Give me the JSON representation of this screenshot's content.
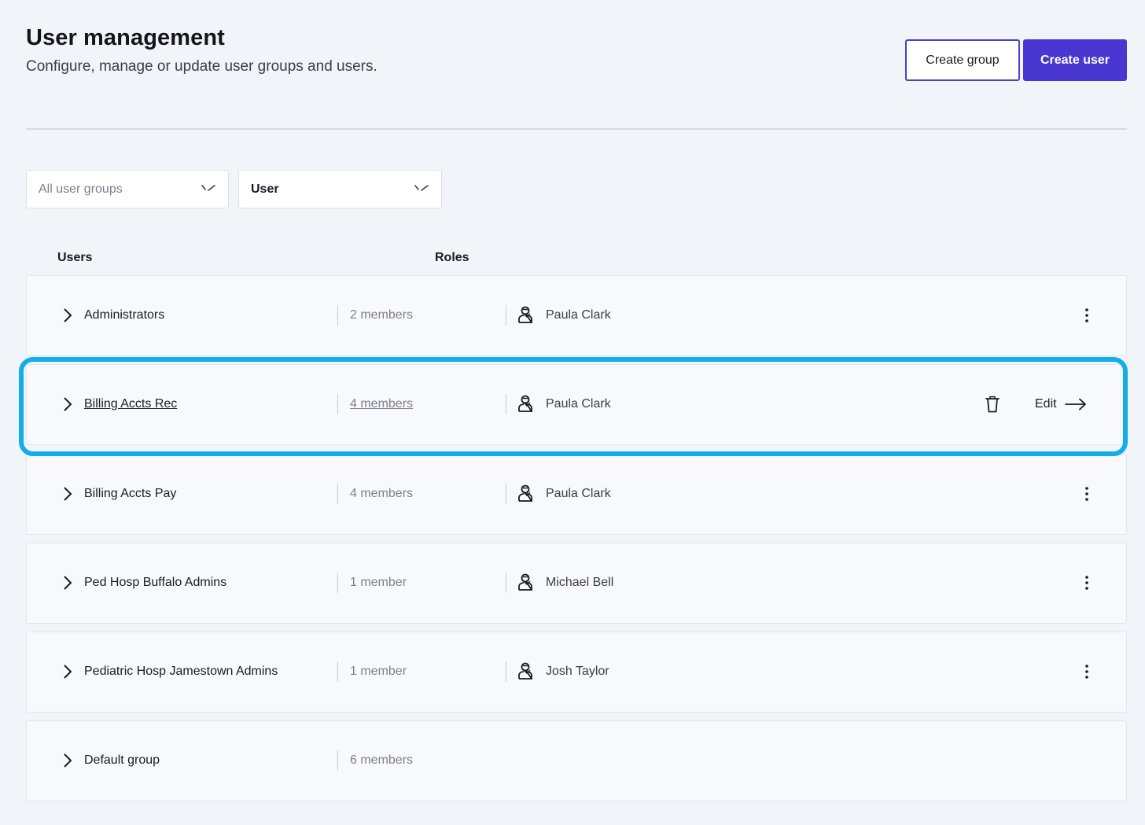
{
  "header": {
    "title": "User management",
    "subtitle": "Configure, manage or update user groups and users.",
    "create_group_label": "Create group",
    "create_user_label": "Create user"
  },
  "filters": {
    "group_filter": "All user groups",
    "type_filter": "User"
  },
  "columns": {
    "users": "Users",
    "roles": "Roles"
  },
  "groups": [
    {
      "name": "Administrators",
      "members": "2 members",
      "owner": "Paula Clark"
    },
    {
      "name": "Billing Accts Rec",
      "members": "4 members",
      "owner": "Paula Clark",
      "edit_label": "Edit",
      "hovered": true
    },
    {
      "name": "Billing Accts Pay",
      "members": "4 members",
      "owner": "Paula Clark"
    },
    {
      "name": "Ped Hosp Buffalo Admins",
      "members": "1 member",
      "owner": "Michael Bell"
    },
    {
      "name": "Pediatric Hosp Jamestown Admins",
      "members": "1 member",
      "owner": "Josh Taylor"
    },
    {
      "name": "Default group",
      "members": "6 members",
      "owner": ""
    }
  ],
  "colors": {
    "primary": "#4a36d0",
    "highlight": "#12aee9",
    "background": "#f1f4f9",
    "row_background": "#f7f9fc"
  },
  "icons": {
    "expand": "chevron-right-icon",
    "owner": "user-icon",
    "more": "more-vertical-icon",
    "delete": "trash-icon",
    "edit_arrow": "arrow-right-icon",
    "dropdown": "chevron-down-icon"
  }
}
